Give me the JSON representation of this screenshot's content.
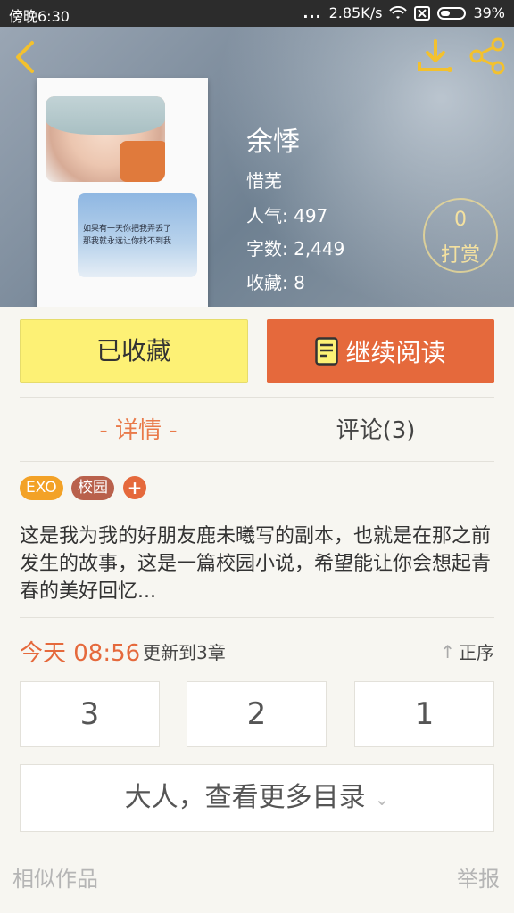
{
  "status_bar": {
    "time": "傍晚6:30",
    "dots": "...",
    "speed": "2.85K/s",
    "battery": "39%",
    "icons": [
      "wifi-icon",
      "sim-icon",
      "battery-icon"
    ]
  },
  "header": {
    "icons": [
      "back-icon",
      "download-icon",
      "share-icon"
    ],
    "title": "余悸",
    "author": "惜芜",
    "popularity": "人气: 497",
    "word_count": "字数: 2,449",
    "favorites": "收藏: 8",
    "tip": {
      "count": "0",
      "label": "打赏"
    },
    "cover": {
      "line1": "如果有一天你把我弄丢了",
      "line2": "那我就永远让你找不到我"
    }
  },
  "actions": {
    "collected_label": "已收藏",
    "continue_label": "继续阅读"
  },
  "tabs": {
    "details": "- 详情 -",
    "comments": "评论(3)"
  },
  "tags": [
    "EXO",
    "校园",
    "+"
  ],
  "description": "这是我为我的好朋友鹿未曦写的副本，也就是在那之前发生的故事，这是一篇校园小说，希望能让你会想起青春的美好回忆...",
  "update": {
    "date": "今天 08:56",
    "text": "更新到3章",
    "sort_label": "正序",
    "sort_icon": "↑"
  },
  "chapters": [
    "3",
    "2",
    "1"
  ],
  "more_catalog": "大人，查看更多目录",
  "footer": {
    "similar": "相似作品",
    "report": "举报"
  },
  "colors": {
    "accent": "#e5693c",
    "collected_bg": "#fdf175",
    "tag_exo": "#f3a227",
    "tag_school": "#b9614c",
    "tip_gold": "#f4e1a0"
  }
}
